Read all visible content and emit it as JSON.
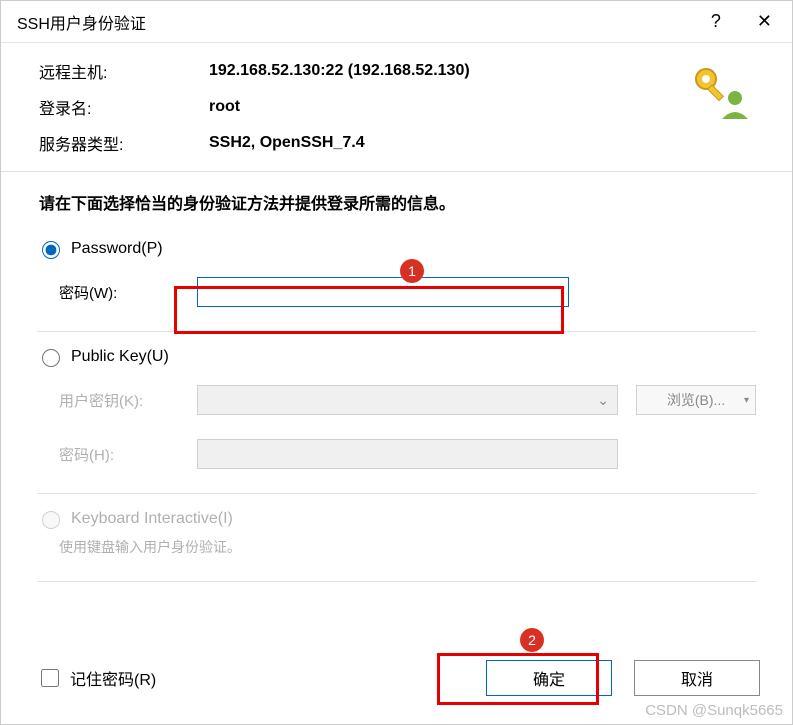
{
  "title": "SSH用户身份验证",
  "help": "?",
  "close": "✕",
  "info": {
    "remote_host_label": "远程主机:",
    "remote_host_value": "192.168.52.130:22 (192.168.52.130)",
    "login_label": "登录名:",
    "login_value": "root",
    "server_type_label": "服务器类型:",
    "server_type_value": "SSH2, OpenSSH_7.4"
  },
  "instruction": "请在下面选择恰当的身份验证方法并提供登录所需的信息。",
  "auth": {
    "password_label": "Password(P)",
    "password_field_label": "密码(W):",
    "publickey_label": "Public Key(U)",
    "user_key_label": "用户密钥(K):",
    "browse_label": "浏览(B)...",
    "passphrase_label": "密码(H):",
    "keyboard_label": "Keyboard Interactive(I)",
    "keyboard_desc": "使用键盘输入用户身份验证。"
  },
  "remember_label": "记住密码(R)",
  "ok_label": "确定",
  "cancel_label": "取消",
  "callouts": {
    "one": "1",
    "two": "2"
  },
  "watermark": "CSDN @Sunqk5665"
}
